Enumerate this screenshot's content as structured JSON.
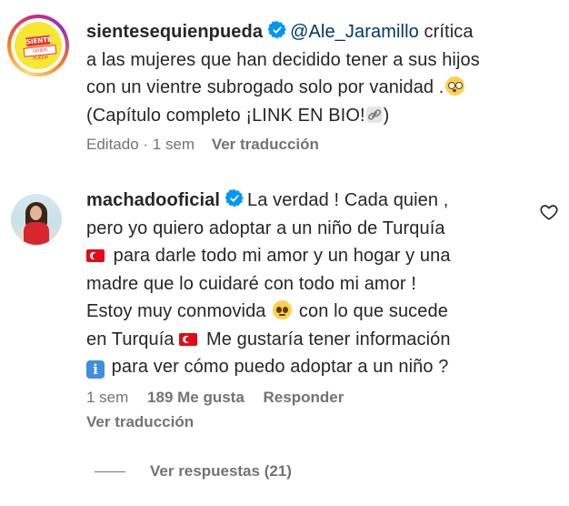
{
  "comments": [
    {
      "username": "sientesequienpueda",
      "mention": "@Ale_Jaramillo",
      "lines": [
        "crítica",
        "a las mujeres que han decidido tener a sus hijos",
        "con un vientre subrogado solo por vanidad .",
        "(Capítulo completo ¡LINK EN BIO!",
        ")"
      ],
      "emojis": [
        "flushed-face",
        "link"
      ],
      "meta": {
        "edited": "Editado",
        "time": "1 sem",
        "translate": "Ver traducción"
      }
    },
    {
      "username": "machadooficial",
      "lines": [
        "La verdad ! Cada quien ,",
        "pero yo quiero adoptar a un niño de Turquía",
        "para darle todo mi amor y un hogar y una",
        "madre que lo cuidaré con todo mi amor !",
        "Estoy muy conmovida",
        "con lo que sucede",
        "en Turquía",
        "Me gustaría tener información",
        "para ver cómo puedo adoptar a un niño ?"
      ],
      "emojis": [
        "turkey-flag",
        "pleading-face",
        "turkey-flag",
        "information"
      ],
      "meta": {
        "time": "1 sem",
        "likes": "189 Me gusta",
        "reply": "Responder",
        "translate": "Ver traducción"
      },
      "replies_link": "Ver respuestas (21)"
    }
  ],
  "colors": {
    "text": "#262626",
    "secondary": "#737373",
    "mention": "#00376b",
    "verified": "#0095f6"
  }
}
